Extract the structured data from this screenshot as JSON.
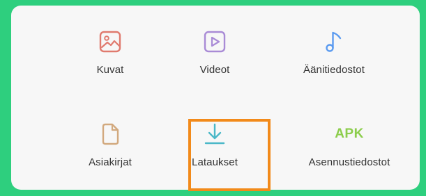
{
  "categories": [
    {
      "label": "Kuvat",
      "icon": "image-icon",
      "color": "#e07a6e"
    },
    {
      "label": "Videot",
      "icon": "video-icon",
      "color": "#a98bd6"
    },
    {
      "label": "Äänitiedostot",
      "icon": "music-note-icon",
      "color": "#5b9bf0"
    },
    {
      "label": "Asiakirjat",
      "icon": "document-icon",
      "color": "#d2a97e"
    },
    {
      "label": "Lataukset",
      "icon": "download-icon",
      "color": "#4bb8c8",
      "highlighted": true
    },
    {
      "label": "Asennustiedostot",
      "icon": "apk-icon",
      "icon_text": "APK",
      "color": "#8ccd4c"
    }
  ],
  "highlight_color": "#f28a1a",
  "background_color": "#2ecf7e"
}
